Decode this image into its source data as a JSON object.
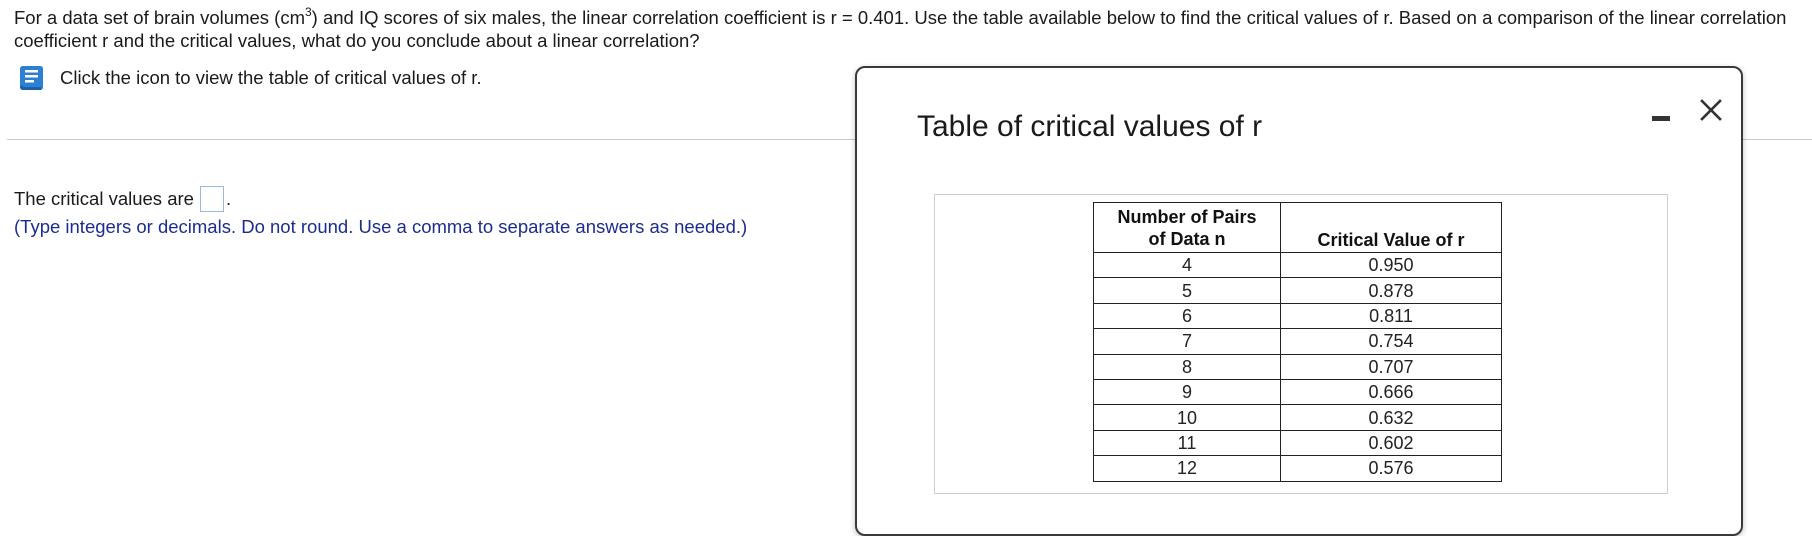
{
  "question": {
    "part1": "For a data set of brain volumes (cm",
    "sup": "3",
    "part2": ") and IQ scores of six males, the linear correlation coefficient is r = 0.401. Use the table available below to find the critical values of r. Based on a comparison of the linear correlation coefficient r and the critical values, what do you conclude about a linear correlation?"
  },
  "hint": {
    "icon": "book-icon",
    "text": "Click the icon to view the table of critical values of r."
  },
  "answer": {
    "prefix": "The critical values are",
    "suffix": ".",
    "value": "",
    "instruction": "(Type integers or decimals. Do not round. Use a comma to separate answers as needed.)"
  },
  "dialog": {
    "title": "Table of critical values of r",
    "minimize_icon": "minimize-icon",
    "close_icon": "close-icon"
  },
  "critical_table": {
    "header_n_line1": "Number of Pairs",
    "header_n_line2": "of Data n",
    "header_r": "Critical Value of r",
    "rows": [
      {
        "n": "4",
        "r": "0.950"
      },
      {
        "n": "5",
        "r": "0.878"
      },
      {
        "n": "6",
        "r": "0.811"
      },
      {
        "n": "7",
        "r": "0.754"
      },
      {
        "n": "8",
        "r": "0.707"
      },
      {
        "n": "9",
        "r": "0.666"
      },
      {
        "n": "10",
        "r": "0.632"
      },
      {
        "n": "11",
        "r": "0.602"
      },
      {
        "n": "12",
        "r": "0.576"
      }
    ]
  },
  "colors": {
    "instruction_text": "#1c2d8f",
    "icon_blue": "#2d7fd3",
    "input_border": "#9ab8dd"
  }
}
